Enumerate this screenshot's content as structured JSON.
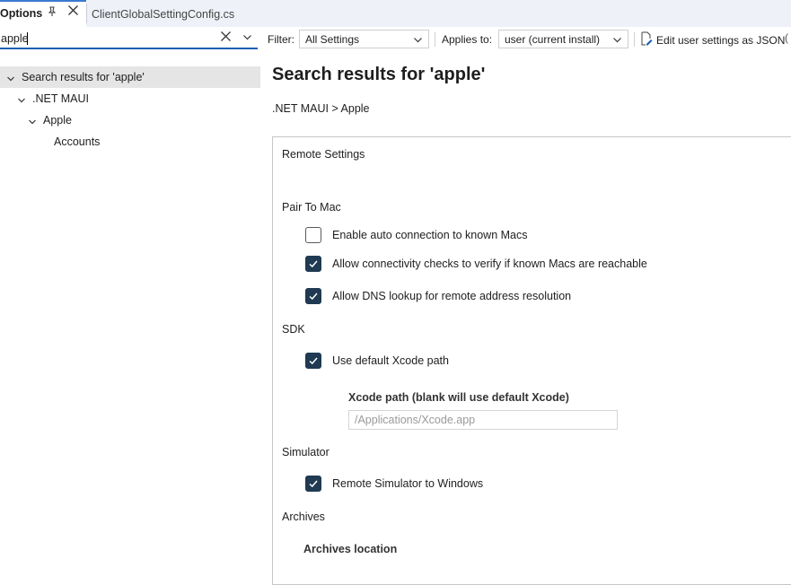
{
  "tabs": [
    {
      "label": "Options",
      "active": true
    },
    {
      "label": "ClientGlobalSettingConfig.cs",
      "active": false
    }
  ],
  "toolbar": {
    "search_value": "apple",
    "filter_label": "Filter:",
    "filter_value": "All Settings",
    "applies_label": "Applies to:",
    "applies_value": "user (current install)",
    "edit_json_label": "Edit user settings as JSON"
  },
  "tree": {
    "items": [
      {
        "label": "Search results for 'apple'"
      },
      {
        "label": ".NET MAUI"
      },
      {
        "label": "Apple"
      },
      {
        "label": "Accounts"
      }
    ]
  },
  "main": {
    "title": "Search results for 'apple'",
    "breadcrumb": ".NET MAUI > Apple",
    "group_title": "Remote Settings",
    "sections": {
      "pair_to_mac": "Pair To Mac",
      "sdk": "SDK",
      "simulator": "Simulator",
      "archives": "Archives"
    },
    "checkboxes": {
      "auto_connect": {
        "label": "Enable auto connection to known Macs",
        "checked": false
      },
      "connectivity": {
        "label": "Allow connectivity checks to verify if known Macs are reachable",
        "checked": true
      },
      "dns_lookup": {
        "label": "Allow DNS lookup for remote address resolution",
        "checked": true
      },
      "default_xcode": {
        "label": "Use default Xcode path",
        "checked": true
      },
      "remote_simulator": {
        "label": "Remote Simulator to Windows",
        "checked": true
      }
    },
    "xcode_path_label": "Xcode path (blank will use default Xcode)",
    "xcode_path_placeholder": "/Applications/Xcode.app",
    "archives_location_label": "Archives location"
  },
  "colors": {
    "accent": "#1a5fb4",
    "checkbox_checked": "#1f3a52",
    "tree_selected": "#e5e5e5",
    "tabstrip_bg": "#eef2f8"
  }
}
